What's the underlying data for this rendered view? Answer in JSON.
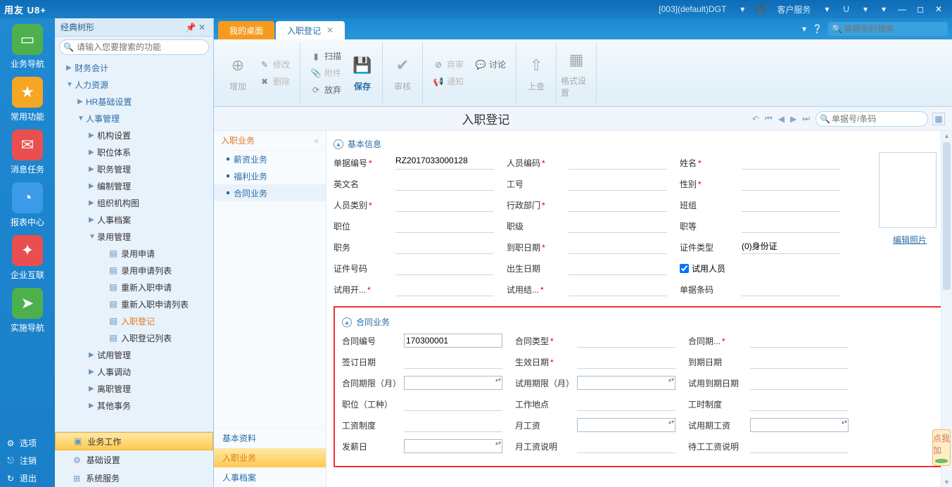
{
  "titlebar": {
    "logo": "用友 U8+",
    "account": "[003](default)DGT",
    "service": "客户服务",
    "u": "U"
  },
  "leftbar": {
    "items": [
      {
        "label": "业务导航",
        "color": "#4db04d",
        "glyph": "▭"
      },
      {
        "label": "常用功能",
        "color": "#f5a623",
        "glyph": "★"
      },
      {
        "label": "消息任务",
        "color": "#e94f4f",
        "glyph": "✉"
      },
      {
        "label": "报表中心",
        "color": "#3b9be8",
        "glyph": "◔"
      },
      {
        "label": "企业互联",
        "color": "#e94f4f",
        "glyph": "✦"
      },
      {
        "label": "实施导航",
        "color": "#4db04d",
        "glyph": "➤"
      }
    ],
    "bottom": [
      {
        "label": "选项",
        "glyph": "⚙"
      },
      {
        "label": "注销",
        "glyph": "⎋"
      },
      {
        "label": "退出",
        "glyph": "↻"
      }
    ]
  },
  "tree": {
    "title": "经典树形",
    "search_placeholder": "请输入您要搜索的功能",
    "nodes": [
      {
        "label": "财务会计",
        "lvl": 1,
        "caret": "▶"
      },
      {
        "label": "人力资源",
        "lvl": 1,
        "caret": "▼"
      },
      {
        "label": "HR基础设置",
        "lvl": 2,
        "caret": "▶"
      },
      {
        "label": "人事管理",
        "lvl": 2,
        "caret": "▼"
      },
      {
        "label": "机构设置",
        "lvl": 3,
        "caret": "▶"
      },
      {
        "label": "职位体系",
        "lvl": 3,
        "caret": "▶"
      },
      {
        "label": "职务管理",
        "lvl": 3,
        "caret": "▶"
      },
      {
        "label": "编制管理",
        "lvl": 3,
        "caret": "▶"
      },
      {
        "label": "组织机构图",
        "lvl": 3,
        "caret": "▶"
      },
      {
        "label": "人事档案",
        "lvl": 3,
        "caret": "▶"
      },
      {
        "label": "录用管理",
        "lvl": 3,
        "caret": "▼"
      },
      {
        "label": "录用申请",
        "lvl": 4,
        "doc": true
      },
      {
        "label": "录用申请列表",
        "lvl": 4,
        "doc": true
      },
      {
        "label": "重新入职申请",
        "lvl": 4,
        "doc": true
      },
      {
        "label": "重新入职申请列表",
        "lvl": 4,
        "doc": true
      },
      {
        "label": "入职登记",
        "lvl": 4,
        "doc": true,
        "sel": true
      },
      {
        "label": "入职登记列表",
        "lvl": 4,
        "doc": true
      },
      {
        "label": "试用管理",
        "lvl": 3,
        "caret": "▶"
      },
      {
        "label": "人事调动",
        "lvl": 3,
        "caret": "▶"
      },
      {
        "label": "离职管理",
        "lvl": 3,
        "caret": "▶"
      },
      {
        "label": "其他事务",
        "lvl": 3,
        "caret": "▶"
      }
    ],
    "footer": [
      {
        "label": "业务工作",
        "active": true,
        "glyph": "▣"
      },
      {
        "label": "基础设置",
        "glyph": "⚙"
      },
      {
        "label": "系统服务",
        "glyph": "⊞"
      }
    ]
  },
  "tabs": {
    "home": "我的桌面",
    "active": "入职登记",
    "search_placeholder": "单据条码搜索"
  },
  "ribbon": {
    "add": "增加",
    "edit": "修改",
    "delete": "删除",
    "scan": "扫描",
    "attach": "附件",
    "discard": "放弃",
    "save": "保存",
    "audit": "审核",
    "deprecate": "弃审",
    "discuss": "讨论",
    "notify": "通知",
    "submit": "上查",
    "format": "格式设置"
  },
  "page": {
    "title": "入职登记",
    "search_placeholder": "单据号/条码"
  },
  "secnav": {
    "header": "入职业务",
    "items": [
      "薪资业务",
      "福利业务",
      "合同业务"
    ],
    "bottom": [
      "基本资料",
      "入职业务",
      "人事档案"
    ]
  },
  "section1": {
    "title": "基本信息"
  },
  "section2": {
    "title": "合同业务"
  },
  "form": {
    "doc_no_lbl": "单据编号",
    "doc_no": "RZ2017033000128",
    "emp_code_lbl": "人员编码",
    "name_lbl": "姓名",
    "eng_lbl": "英文名",
    "workno_lbl": "工号",
    "gender_lbl": "性别",
    "cat_lbl": "人员类别",
    "dept_lbl": "行政部门",
    "team_lbl": "班组",
    "pos_lbl": "职位",
    "rank_lbl": "职级",
    "grade_lbl": "职等",
    "duty_lbl": "职务",
    "ondate_lbl": "到职日期",
    "idtype_lbl": "证件类型",
    "idtype": "(0)身份证",
    "idno_lbl": "证件号码",
    "birth_lbl": "出生日期",
    "trial_lbl": "试用人员",
    "trial_start_lbl": "试用开...",
    "trial_end_lbl": "试用结...",
    "barcode_lbl": "单据条码",
    "photo": "编辑照片"
  },
  "contract": {
    "no_lbl": "合同编号",
    "no": "170300001",
    "type_lbl": "合同类型",
    "period_lbl": "合同期...",
    "sign_lbl": "签订日期",
    "eff_lbl": "生效日期",
    "exp_lbl": "到期日期",
    "term_lbl": "合同期限（月）",
    "trial_term_lbl": "试用期限（月）",
    "trial_exp_lbl": "试用到期日期",
    "job_lbl": "职位（工种）",
    "loc_lbl": "工作地点",
    "hour_lbl": "工时制度",
    "wage_lbl": "工资制度",
    "month_lbl": "月工资",
    "trial_wage_lbl": "试用期工资",
    "payday_lbl": "发薪日",
    "month_desc_lbl": "月工资说明",
    "wait_desc_lbl": "待工工资说明"
  },
  "float": "点我加"
}
